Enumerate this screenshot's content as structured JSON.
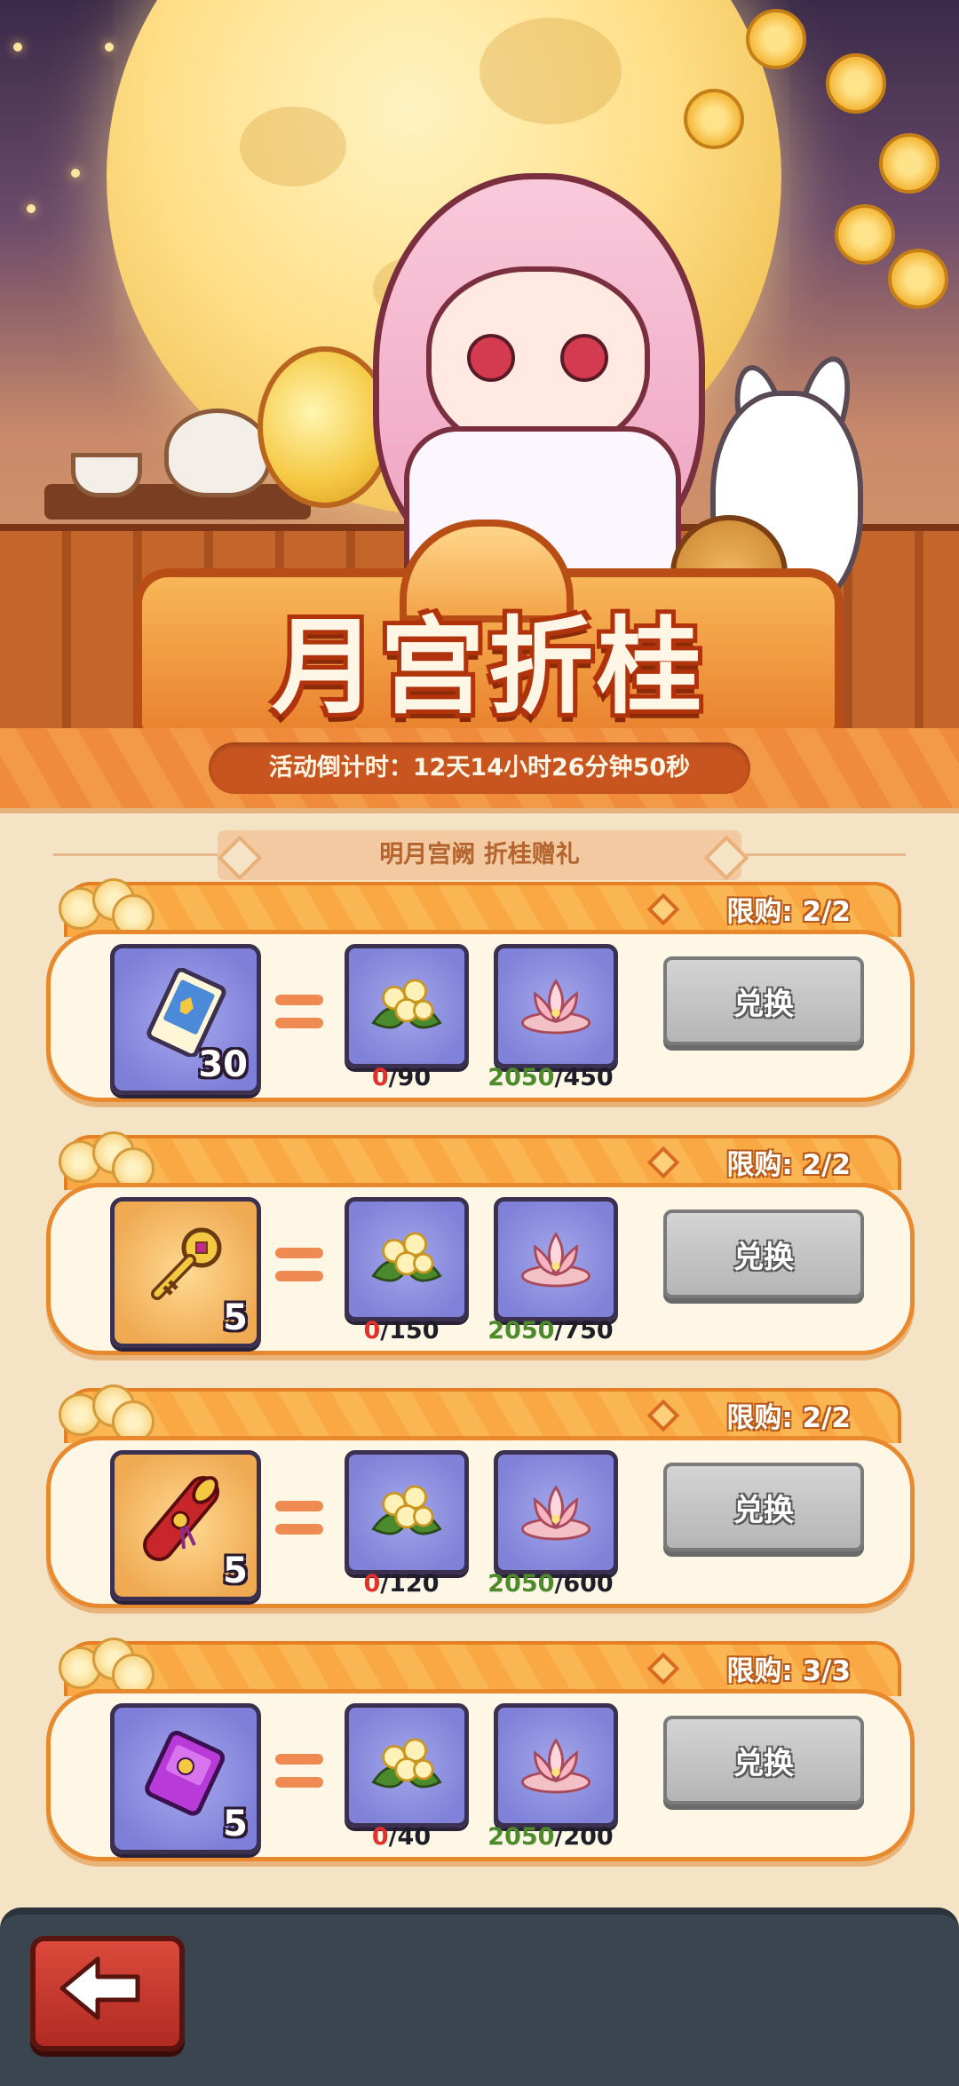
{
  "event": {
    "title": "月宫折桂",
    "countdown": "活动倒计时：12天14小时26分钟50秒",
    "subtitle": "明月宫阙  折桂赠礼"
  },
  "colors": {
    "have_insufficient": "#e2302a",
    "have_sufficient": "#4c8a2c",
    "button_disabled": "#b5b5b5",
    "back_button": "#c0362c"
  },
  "offers": [
    {
      "limit": "限购: 2/2",
      "reward_icon": "ticket-icon",
      "reward_count": "30",
      "cost1": {
        "icon": "osmanthus-icon",
        "have": "0",
        "need": "/90"
      },
      "cost2": {
        "icon": "lotus-lantern-icon",
        "have": "2050",
        "need": "/450"
      },
      "button": "兑换"
    },
    {
      "limit": "限购: 2/2",
      "reward_icon": "golden-key-icon",
      "reward_count": "5",
      "cost1": {
        "icon": "osmanthus-icon",
        "have": "0",
        "need": "/150"
      },
      "cost2": {
        "icon": "lotus-lantern-icon",
        "have": "2050",
        "need": "/750"
      },
      "button": "兑换"
    },
    {
      "limit": "限购: 2/2",
      "reward_icon": "red-scroll-icon",
      "reward_count": "5",
      "cost1": {
        "icon": "osmanthus-icon",
        "have": "0",
        "need": "/120"
      },
      "cost2": {
        "icon": "lotus-lantern-icon",
        "have": "2050",
        "need": "/600"
      },
      "button": "兑换"
    },
    {
      "limit": "限购: 3/3",
      "reward_icon": "purple-ticket-icon",
      "reward_count": "5",
      "cost1": {
        "icon": "osmanthus-icon",
        "have": "0",
        "need": "/40"
      },
      "cost2": {
        "icon": "lotus-lantern-icon",
        "have": "2050",
        "need": "/200"
      },
      "button": "兑换"
    }
  ],
  "bottom_bar": {
    "back_icon": "back-arrow-icon"
  }
}
